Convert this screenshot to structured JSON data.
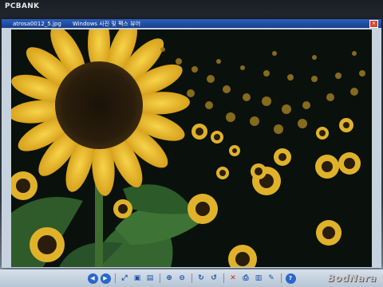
{
  "watermark_top": "PCBANK",
  "window": {
    "file_name": "atrosa0012_5.jpg",
    "app_title": "Windows 사진 및 팩스 뷰어",
    "close_glyph": "×"
  },
  "photo": {
    "subject": "sunflower field at night"
  },
  "toolbar": {
    "buttons": [
      {
        "name": "previous-image-button",
        "glyph": "◀",
        "icon": "arrow-left-icon"
      },
      {
        "name": "next-image-button",
        "glyph": "▶",
        "icon": "arrow-right-icon"
      },
      {
        "name": "best-fit-button",
        "glyph": "⤢",
        "icon": "fit-icon"
      },
      {
        "name": "actual-size-button",
        "glyph": "▣",
        "icon": "actual-size-icon"
      },
      {
        "name": "slideshow-button",
        "glyph": "▤",
        "icon": "slideshow-icon"
      },
      {
        "name": "zoom-in-button",
        "glyph": "⊕",
        "icon": "zoom-in-icon"
      },
      {
        "name": "zoom-out-button",
        "glyph": "⊖",
        "icon": "zoom-out-icon"
      },
      {
        "name": "rotate-cw-button",
        "glyph": "↻",
        "icon": "rotate-cw-icon"
      },
      {
        "name": "rotate-ccw-button",
        "glyph": "↺",
        "icon": "rotate-ccw-icon"
      },
      {
        "name": "delete-button",
        "glyph": "✕",
        "icon": "delete-icon"
      },
      {
        "name": "print-button",
        "glyph": "⎙",
        "icon": "print-icon"
      },
      {
        "name": "save-button",
        "glyph": "▥",
        "icon": "save-icon"
      },
      {
        "name": "edit-button",
        "glyph": "✎",
        "icon": "edit-icon"
      },
      {
        "name": "help-button",
        "glyph": "?",
        "icon": "help-icon"
      }
    ]
  },
  "brand": "BodNara",
  "colors": {
    "titlebar": "#1a3f8a",
    "toolbar_icon": "#1c4fa8",
    "petal": "#f2c230"
  }
}
